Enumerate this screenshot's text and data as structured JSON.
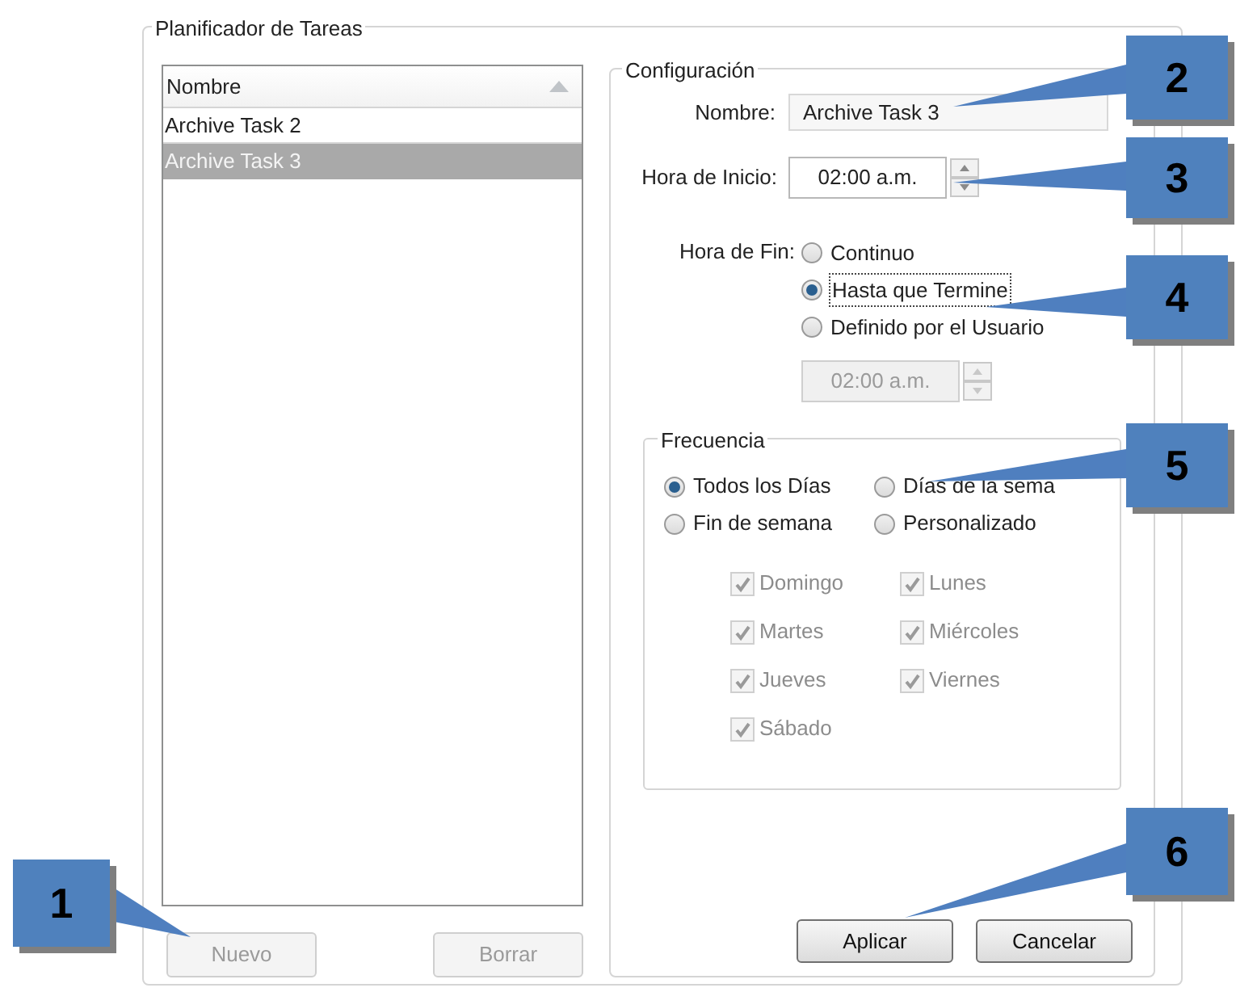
{
  "group_title": "Planificador de Tareas",
  "task_list": {
    "column": "Nombre",
    "rows": [
      {
        "name": "Archive Task 2",
        "selected": false
      },
      {
        "name": "Archive Task 3",
        "selected": true
      }
    ]
  },
  "list_buttons": [
    {
      "label": "Nuevo",
      "disabled": true
    },
    {
      "label": "Borrar",
      "disabled": true
    }
  ],
  "configuration": {
    "title": "Configuración",
    "name_label": "Nombre:",
    "name_value": "Archive Task 3",
    "start_label": "Hora de Inicio:",
    "start_value": "02:00 a.m.",
    "end_label": "Hora de Fin:",
    "end_options": [
      {
        "label": "Continuo",
        "selected": false
      },
      {
        "label": "Hasta que Termine",
        "selected": true
      },
      {
        "label": "Definido por el Usuario",
        "selected": false
      }
    ],
    "end_time": {
      "value": "02:00 a.m.",
      "disabled": true
    }
  },
  "frequency": {
    "title": "Frecuencia",
    "options": [
      {
        "label": "Todos los Días",
        "selected": true
      },
      {
        "label": "Días de la sema",
        "selected": false
      },
      {
        "label": "Fin de semana",
        "selected": false
      },
      {
        "label": "Personalizado",
        "selected": false
      }
    ],
    "days": [
      {
        "label": "Domingo",
        "checked": true,
        "disabled": true
      },
      {
        "label": "Lunes",
        "checked": true,
        "disabled": true
      },
      {
        "label": "Martes",
        "checked": true,
        "disabled": true
      },
      {
        "label": "Miércoles",
        "checked": true,
        "disabled": true
      },
      {
        "label": "Jueves",
        "checked": true,
        "disabled": true
      },
      {
        "label": "Viernes",
        "checked": true,
        "disabled": true
      },
      {
        "label": "Sábado",
        "checked": true,
        "disabled": true
      }
    ]
  },
  "buttons": [
    {
      "label": "Aplicar"
    },
    {
      "label": "Cancelar"
    }
  ],
  "callouts": [
    {
      "number": "1"
    },
    {
      "number": "2"
    },
    {
      "number": "3"
    },
    {
      "number": "4"
    },
    {
      "number": "5"
    },
    {
      "number": "6"
    }
  ]
}
